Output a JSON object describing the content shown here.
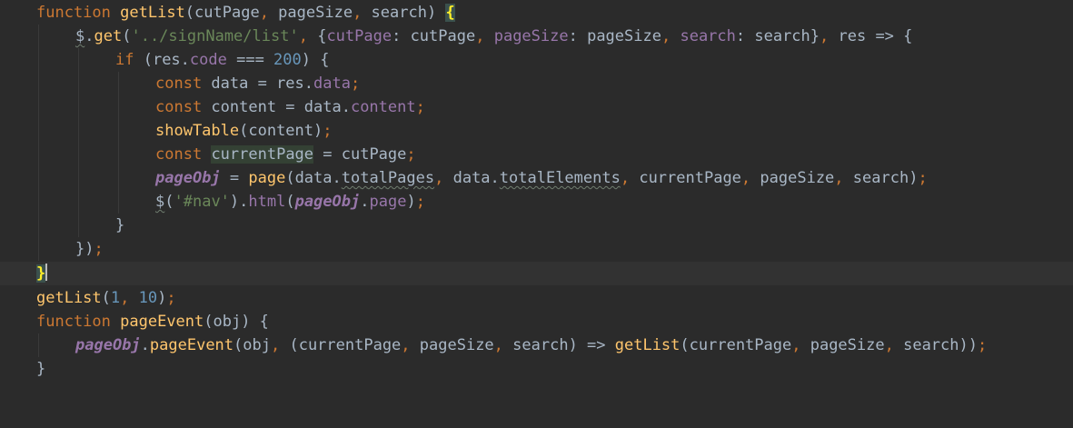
{
  "editor": {
    "theme_colors": {
      "background": "#2b2b2b",
      "keyword": "#cc7832",
      "function": "#ffc66d",
      "string": "#6a8759",
      "number": "#6897bb",
      "property": "#9876aa",
      "text": "#a9b7c6"
    },
    "lines": [
      {
        "tokens": [
          "function",
          "getList",
          "(cutPage",
          ",",
          " pageSize",
          ",",
          " search) ",
          "{"
        ]
      },
      {
        "tokens": [
          "$",
          ".",
          "get",
          "(",
          "'../signName/list'",
          ",",
          " {",
          "cutPage",
          ": cutPage",
          ",",
          " ",
          "pageSize",
          ": pageSize",
          ",",
          " ",
          "search",
          ": search}",
          ",",
          " res => {"
        ]
      },
      {
        "tokens": [
          "if",
          " (res.",
          "code",
          " === ",
          "200",
          ") {"
        ]
      },
      {
        "tokens": [
          "const",
          " data = res.",
          "data",
          ";"
        ]
      },
      {
        "tokens": [
          "const",
          " content = data.",
          "content",
          ";"
        ]
      },
      {
        "tokens": [
          "showTable",
          "(content)",
          ";"
        ]
      },
      {
        "tokens": [
          "const",
          " ",
          "currentPage",
          " = cutPage",
          ";"
        ]
      },
      {
        "tokens": [
          "pageObj",
          " = ",
          "page",
          "(data.",
          "totalPages",
          ",",
          " data.",
          "totalElements",
          ",",
          " currentPage",
          ",",
          " pageSize",
          ",",
          " search)",
          ";"
        ]
      },
      {
        "tokens": [
          "$",
          "(",
          "'#nav'",
          ").",
          "html",
          "(",
          "pageObj",
          ".",
          "page",
          ")",
          ";"
        ]
      },
      {
        "tokens": [
          "}"
        ]
      },
      {
        "tokens": [
          "})",
          ";"
        ]
      },
      {
        "tokens": [
          "}"
        ]
      },
      {
        "tokens": [
          "getList",
          "(",
          "1",
          ",",
          " ",
          "10",
          ")",
          ";"
        ]
      },
      {
        "tokens": [
          "function",
          " ",
          "pageEvent",
          "(obj) {"
        ]
      },
      {
        "tokens": [
          "pageObj",
          ".",
          "pageEvent",
          "(obj",
          ",",
          " (currentPage",
          ",",
          " pageSize",
          ",",
          " search) => ",
          "getList",
          "(currentPage",
          ",",
          " pageSize",
          ",",
          " search))",
          ";"
        ]
      },
      {
        "tokens": [
          "}"
        ]
      }
    ]
  }
}
